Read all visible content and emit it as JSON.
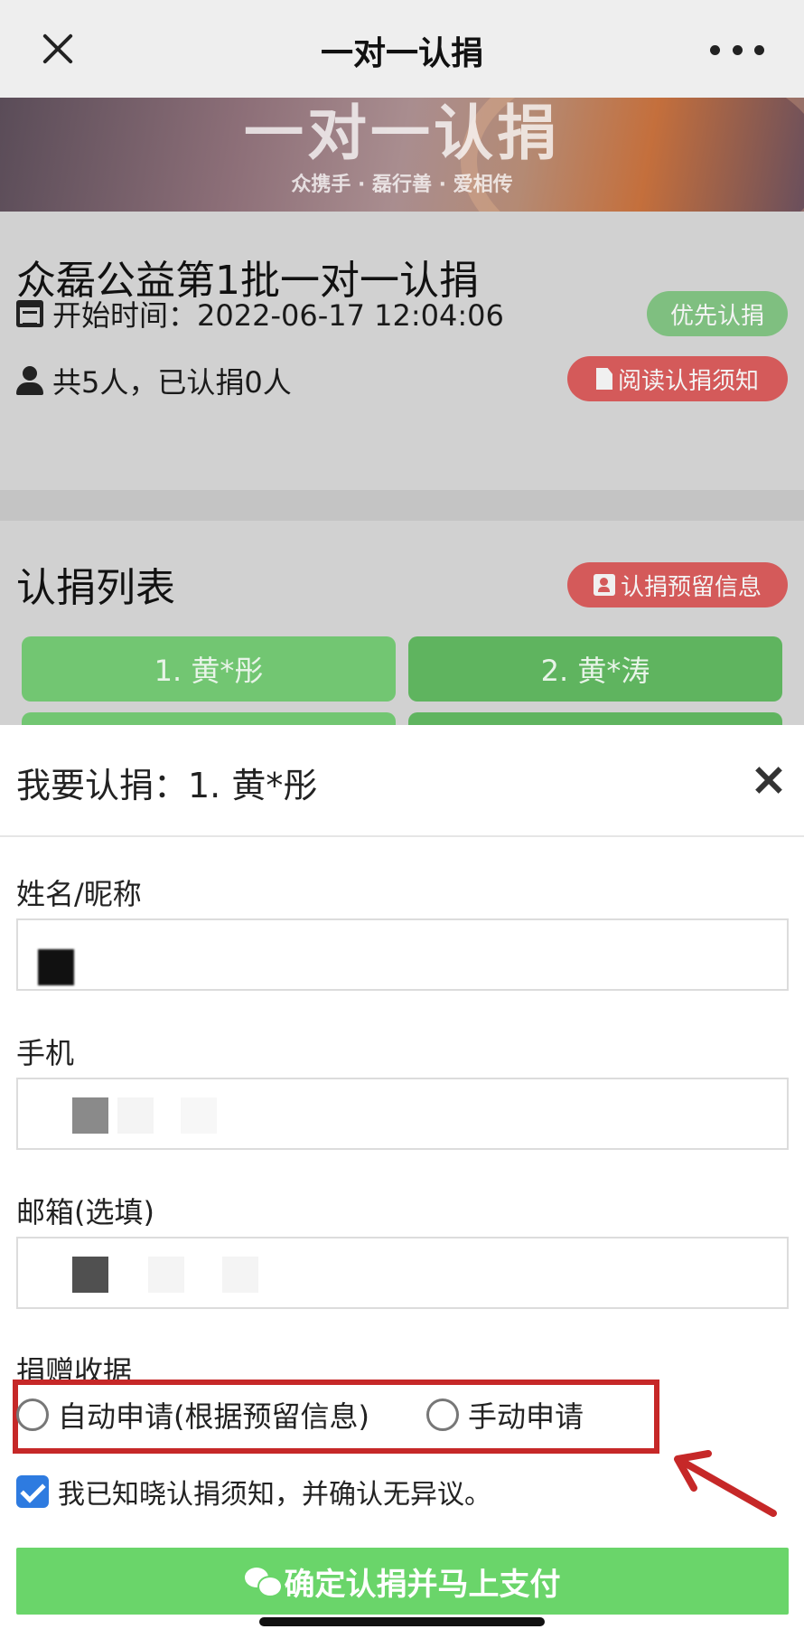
{
  "nav": {
    "title": "一对一认捐"
  },
  "banner": {
    "title": "一对一认捐",
    "subtitle": "众携手 · 磊行善 · 爱相传"
  },
  "info": {
    "title": "众磊公益第1批一对一认捐",
    "start_time": "开始时间：2022-06-17 12:04:06",
    "priority_label": "优先认捐",
    "count_text": "共5人，已认捐0人",
    "read_notice_label": "阅读认捐须知"
  },
  "list": {
    "title": "认捐列表",
    "reserved_info_label": "认捐预留信息",
    "items": [
      {
        "label": "1. 黄*彤"
      },
      {
        "label": "2. 黄*涛"
      }
    ]
  },
  "modal": {
    "title": "我要认捐：1. 黄*彤",
    "name_label": "姓名/昵称",
    "phone_label": "手机",
    "email_label": "邮箱(选填)",
    "receipt_label": "捐赠收据",
    "receipt_options": [
      "自动申请(根据预留信息)",
      "手动申请"
    ],
    "agree_text": "我已知晓认捐须知，并确认无异议。",
    "pay_button": "确定认捐并马上支付"
  },
  "colors": {
    "green_button": "#6ad56a",
    "red_pill": "#d45a5a",
    "checkbox_blue": "#2e7be0",
    "highlight_red": "#c62828"
  },
  "icons": [
    "close-icon",
    "more-icon",
    "calendar-icon",
    "person-icon",
    "document-icon",
    "contact-card-icon",
    "wechat-icon"
  ]
}
